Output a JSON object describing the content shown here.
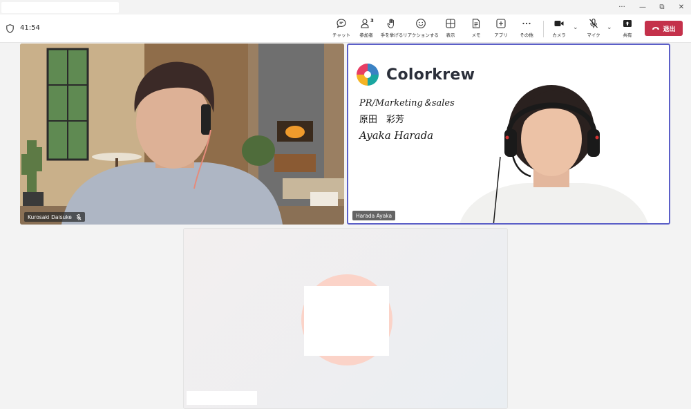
{
  "window": {
    "title": "",
    "controls": [
      "more-icon",
      "minimize-icon",
      "restore-icon",
      "close-icon"
    ],
    "control_glyphs": [
      "···",
      "—",
      "⧉",
      "✕"
    ]
  },
  "toolbar": {
    "timer": "41:54",
    "buttons": [
      {
        "id": "chat",
        "label": "チャット",
        "icon": "chat-icon"
      },
      {
        "id": "participants",
        "label": "参加者",
        "icon": "people-icon",
        "count": "3"
      },
      {
        "id": "raise-hand",
        "label": "手を挙げる",
        "icon": "hand-icon"
      },
      {
        "id": "react",
        "label": "リアクションする",
        "icon": "smile-icon"
      },
      {
        "id": "view",
        "label": "表示",
        "icon": "grid-icon"
      },
      {
        "id": "notes",
        "label": "メモ",
        "icon": "notes-icon"
      },
      {
        "id": "apps",
        "label": "アプリ",
        "icon": "plus-icon"
      },
      {
        "id": "more",
        "label": "その他",
        "icon": "more-icon"
      },
      {
        "id": "camera",
        "label": "カメラ",
        "icon": "camera-icon"
      },
      {
        "id": "mic",
        "label": "マイク",
        "icon": "mic-off-icon"
      },
      {
        "id": "share",
        "label": "共有",
        "icon": "share-icon"
      }
    ],
    "leave_label": "退出",
    "leave_color": "#c4314b"
  },
  "participants": [
    {
      "name": "Kurosaki Daisuke",
      "muted": true
    },
    {
      "name": "Harada Ayaka",
      "muted": false,
      "active_speaker": true,
      "border_color": "#5b5fc7"
    },
    {
      "name": "",
      "muted": false
    }
  ],
  "background_card": {
    "brand": "Colorkrew",
    "line1": "PR/Marketing＆sales",
    "line2": "原田　彩芳",
    "line3": "Ayaka Harada"
  }
}
